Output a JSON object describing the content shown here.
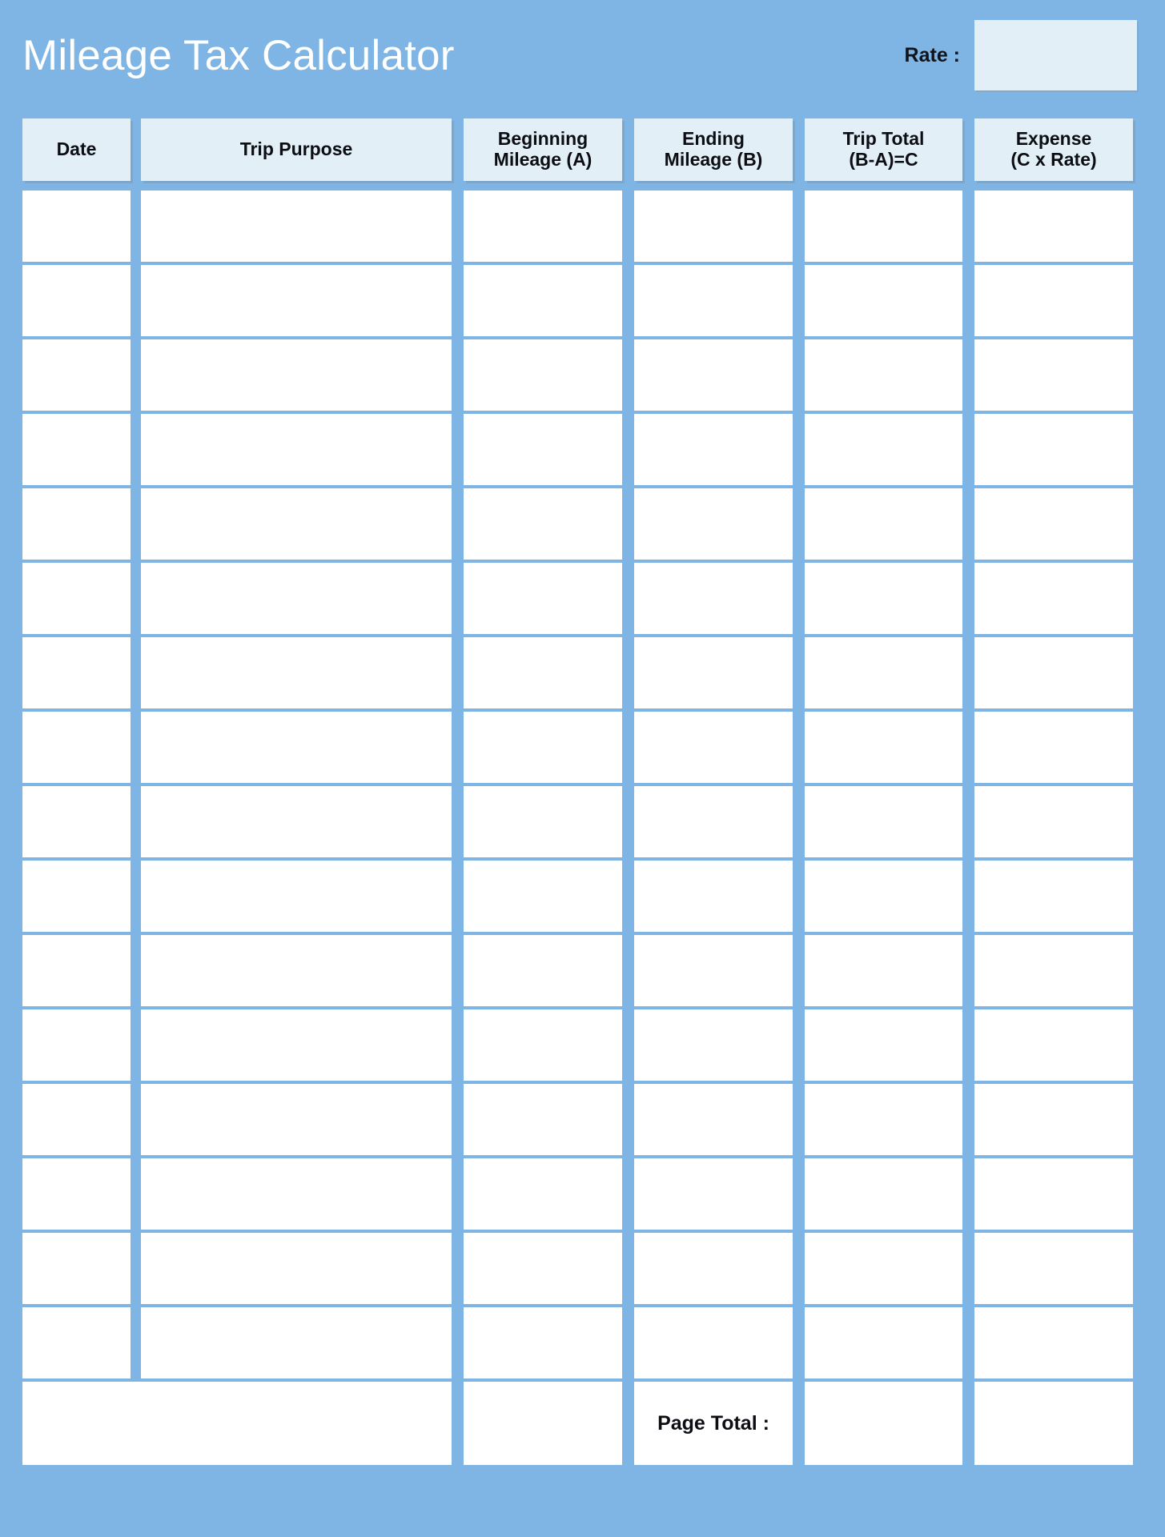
{
  "document": {
    "title": "Mileage Tax Calculator"
  },
  "rate": {
    "label": "Rate :",
    "value": "",
    "placeholder": ""
  },
  "table": {
    "columns": [
      {
        "key": "date",
        "label_line1": "Date",
        "label_line2": ""
      },
      {
        "key": "purpose",
        "label_line1": "Trip Purpose",
        "label_line2": ""
      },
      {
        "key": "begin",
        "label_line1": "Beginning",
        "label_line2": "Mileage (A)"
      },
      {
        "key": "end",
        "label_line1": "Ending",
        "label_line2": "Mileage (B)"
      },
      {
        "key": "total",
        "label_line1": "Trip Total",
        "label_line2": "(B-A)=C"
      },
      {
        "key": "expense",
        "label_line1": "Expense",
        "label_line2": "(C x Rate)"
      }
    ],
    "row_count": 16,
    "rows": [
      {
        "date": "",
        "purpose": "",
        "begin": "",
        "end": "",
        "total": "",
        "expense": ""
      },
      {
        "date": "",
        "purpose": "",
        "begin": "",
        "end": "",
        "total": "",
        "expense": ""
      },
      {
        "date": "",
        "purpose": "",
        "begin": "",
        "end": "",
        "total": "",
        "expense": ""
      },
      {
        "date": "",
        "purpose": "",
        "begin": "",
        "end": "",
        "total": "",
        "expense": ""
      },
      {
        "date": "",
        "purpose": "",
        "begin": "",
        "end": "",
        "total": "",
        "expense": ""
      },
      {
        "date": "",
        "purpose": "",
        "begin": "",
        "end": "",
        "total": "",
        "expense": ""
      },
      {
        "date": "",
        "purpose": "",
        "begin": "",
        "end": "",
        "total": "",
        "expense": ""
      },
      {
        "date": "",
        "purpose": "",
        "begin": "",
        "end": "",
        "total": "",
        "expense": ""
      },
      {
        "date": "",
        "purpose": "",
        "begin": "",
        "end": "",
        "total": "",
        "expense": ""
      },
      {
        "date": "",
        "purpose": "",
        "begin": "",
        "end": "",
        "total": "",
        "expense": ""
      },
      {
        "date": "",
        "purpose": "",
        "begin": "",
        "end": "",
        "total": "",
        "expense": ""
      },
      {
        "date": "",
        "purpose": "",
        "begin": "",
        "end": "",
        "total": "",
        "expense": ""
      },
      {
        "date": "",
        "purpose": "",
        "begin": "",
        "end": "",
        "total": "",
        "expense": ""
      },
      {
        "date": "",
        "purpose": "",
        "begin": "",
        "end": "",
        "total": "",
        "expense": ""
      },
      {
        "date": "",
        "purpose": "",
        "begin": "",
        "end": "",
        "total": "",
        "expense": ""
      },
      {
        "date": "",
        "purpose": "",
        "begin": "",
        "end": "",
        "total": "",
        "expense": ""
      }
    ],
    "footer": {
      "label": "Page Total :",
      "total_value": "",
      "expense_value": ""
    }
  },
  "colors": {
    "page_background": "#7eb5e4",
    "header_cell": "#e2eff7",
    "body_cell": "#ffffff",
    "title_text": "#ffffff",
    "body_text": "#0c0e13"
  }
}
